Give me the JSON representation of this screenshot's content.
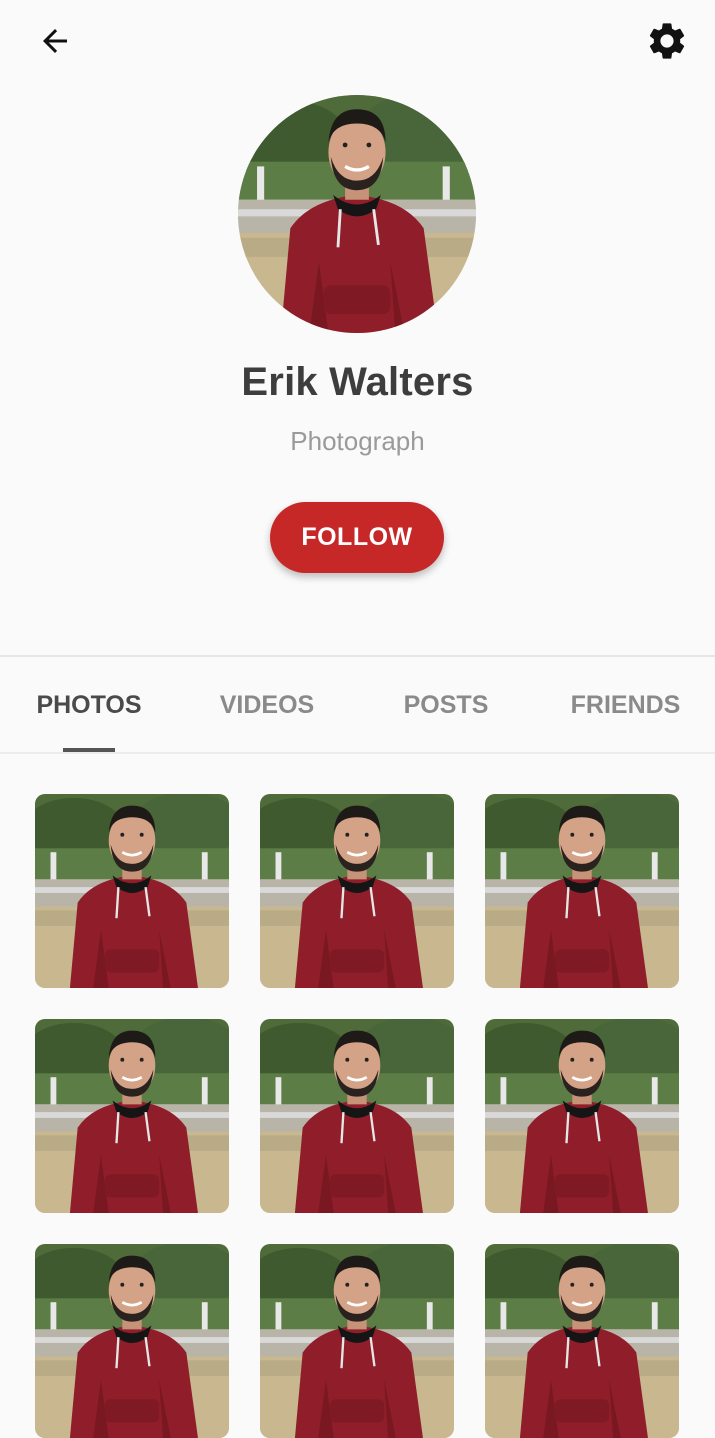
{
  "header": {
    "back_icon": "arrow-back-icon",
    "settings_icon": "gear-icon"
  },
  "profile": {
    "name": "Erik Walters",
    "role": "Photograph",
    "follow_label": "FOLLOW"
  },
  "tabs": [
    {
      "label": "PHOTOS",
      "active": true
    },
    {
      "label": "VIDEOS",
      "active": false
    },
    {
      "label": "POSTS",
      "active": false
    },
    {
      "label": "FRIENDS",
      "active": false
    }
  ],
  "photos": {
    "count_visible_rows": 2,
    "partial_row": true,
    "description": "grid of profile photos"
  },
  "colors": {
    "accent": "#c62828",
    "background": "#fafafa",
    "name_text": "#3d3d3d",
    "muted_text": "#9a9a9a"
  }
}
